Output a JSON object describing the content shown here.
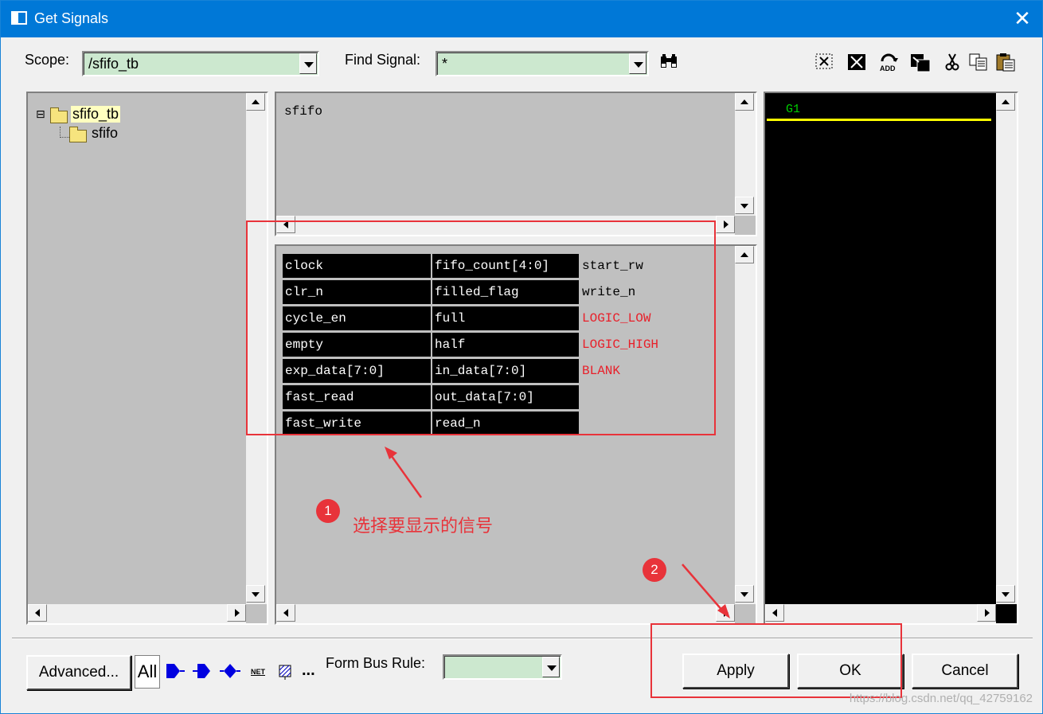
{
  "window": {
    "title": "Get Signals"
  },
  "scope": {
    "label": "Scope:",
    "value": "/sfifo_tb"
  },
  "find": {
    "label": "Find Signal:",
    "value": "*"
  },
  "tree": {
    "root": "sfifo_tb",
    "child": "sfifo",
    "expander": "⊟"
  },
  "scope_list": {
    "items": [
      "sfifo"
    ]
  },
  "signals": {
    "col1": [
      "clock",
      "clr_n",
      "cycle_en",
      "empty",
      "exp_data[7:0]",
      "fast_read",
      "fast_write"
    ],
    "col2": [
      "fifo_count[4:0]",
      "filled_flag",
      "full",
      "half",
      "in_data[7:0]",
      "out_data[7:0]",
      "read_n"
    ],
    "col3": [
      "start_rw",
      "write_n"
    ],
    "col3_constants": [
      "LOGIC_LOW",
      "LOGIC_HIGH",
      "BLANK"
    ]
  },
  "group_panel": {
    "group_name": "G1"
  },
  "bottom": {
    "advanced": "Advanced...",
    "all_label": "All",
    "net_label": "NET",
    "more": "...",
    "form_bus_label": "Form Bus Rule:",
    "form_bus_value": ""
  },
  "buttons": {
    "apply": "Apply",
    "ok": "OK",
    "cancel": "Cancel"
  },
  "annotations": {
    "n1": "1",
    "n1_text": "选择要显示的信号",
    "n2": "2"
  },
  "watermark": "https://blog.csdn.net/qq_42759162",
  "colors": {
    "accent": "#0078d7",
    "annotation": "#e8333a",
    "constant_text": "#e8202a",
    "input_bg": "#cce8cf",
    "group_line": "#ffff00",
    "group_text": "#00d000"
  }
}
